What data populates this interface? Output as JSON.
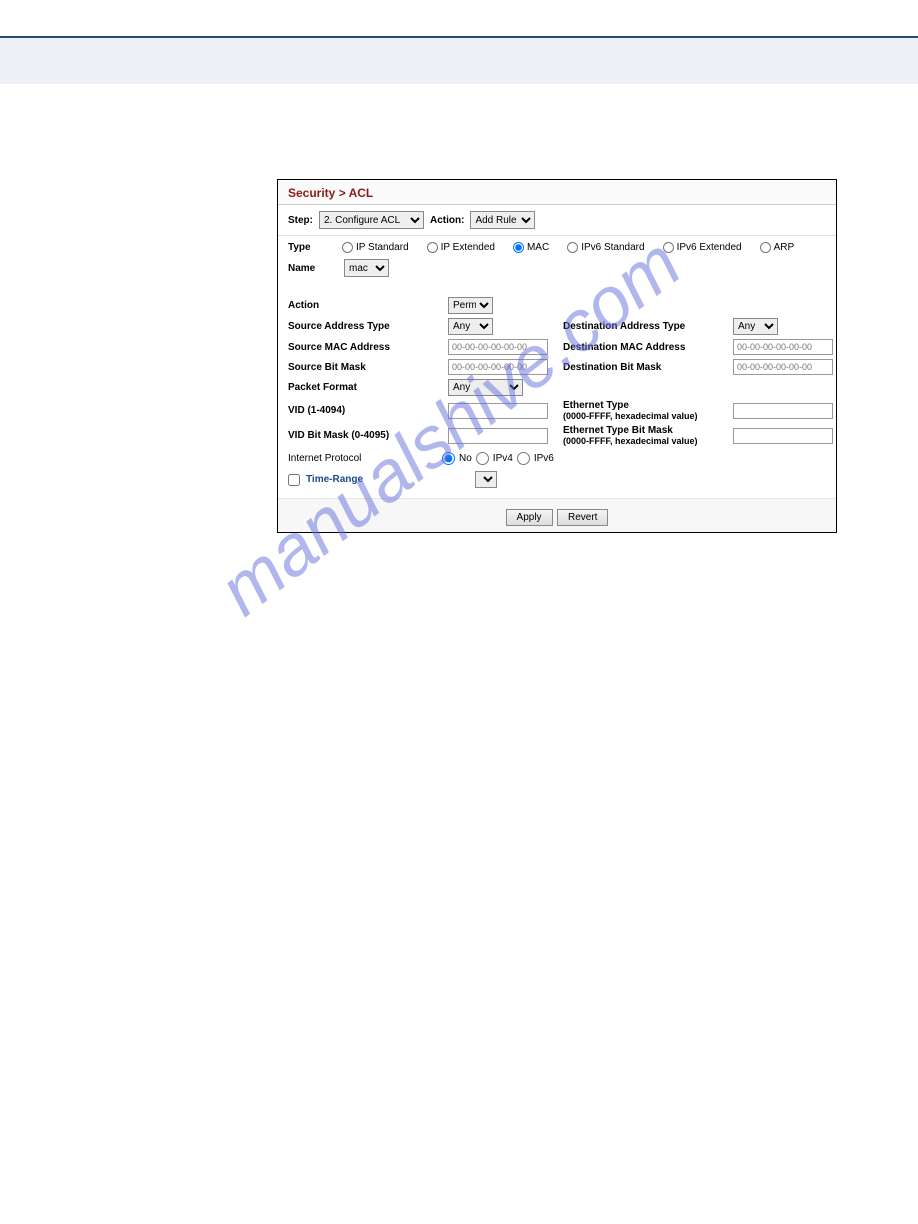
{
  "breadcrumb": "Security > ACL",
  "stepLabel": "Step:",
  "stepValue": "2. Configure ACL",
  "actionLabel": "Action:",
  "actionValue": "Add Rule",
  "typeLabel": "Type",
  "types": {
    "ipStd": "IP Standard",
    "ipExt": "IP Extended",
    "mac": "MAC",
    "ipv6Std": "IPv6 Standard",
    "ipv6Ext": "IPv6 Extended",
    "arp": "ARP"
  },
  "nameLabel": "Name",
  "nameValue": "mac",
  "form": {
    "actionLbl": "Action",
    "actionVal": "Permit",
    "srcAddrType": "Source Address Type",
    "srcAddrTypeVal": "Any",
    "dstAddrType": "Destination Address Type",
    "dstAddrTypeVal": "Any",
    "srcMac": "Source MAC Address",
    "srcMacPh": "00-00-00-00-00-00",
    "dstMac": "Destination MAC Address",
    "dstMacPh": "00-00-00-00-00-00",
    "srcBitMask": "Source Bit Mask",
    "srcBitMaskPh": "00-00-00-00-00-00",
    "dstBitMask": "Destination Bit Mask",
    "dstBitMaskPh": "00-00-00-00-00-00",
    "pktFormat": "Packet Format",
    "pktFormatVal": "Any",
    "vid": "VID (1-4094)",
    "ethType": "Ethernet Type",
    "ethTypeHint": "(0000-FFFF, hexadecimal value)",
    "vidBitMask": "VID Bit Mask (0-4095)",
    "ethTypeBitMask": "Ethernet Type Bit Mask",
    "ethTypeBitMaskHint": "(0000-FFFF, hexadecimal value)",
    "ipLbl": "Internet Protocol",
    "ipNo": "No",
    "ipV4": "IPv4",
    "ipV6": "IPv6",
    "timeRange": "Time-Range"
  },
  "buttons": {
    "apply": "Apply",
    "revert": "Revert"
  },
  "watermark": "manualshive.com"
}
